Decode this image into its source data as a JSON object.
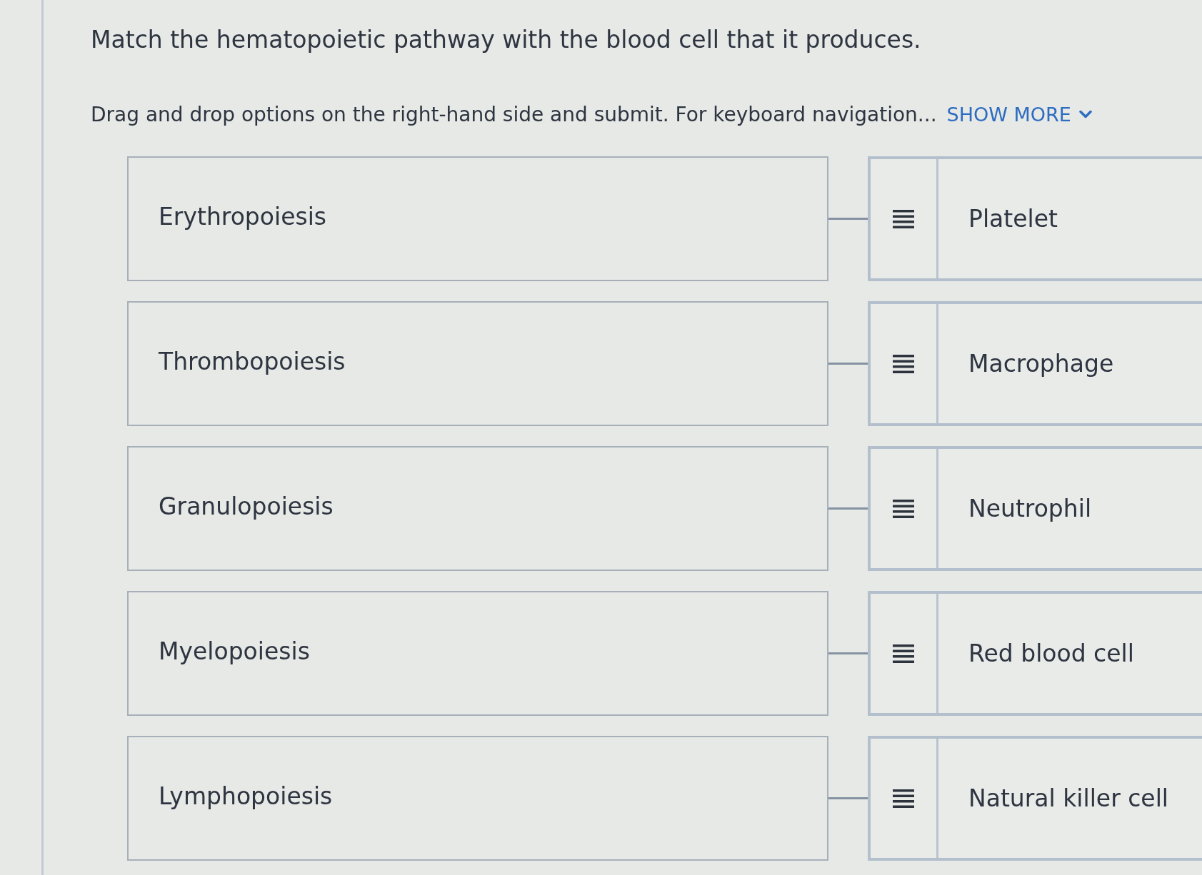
{
  "prompt": {
    "title": "Match the hematopoietic pathway with the blood cell that it produces.",
    "instructions": "Drag and drop options on the right-hand side and submit. For keyboard navigation...",
    "show_more": "SHOW MORE"
  },
  "rows": [
    {
      "pathway": "Erythropoiesis",
      "option": "Platelet"
    },
    {
      "pathway": "Thrombopoiesis",
      "option": "Macrophage"
    },
    {
      "pathway": "Granulopoiesis",
      "option": "Neutrophil"
    },
    {
      "pathway": "Myelopoiesis",
      "option": "Red blood cell"
    },
    {
      "pathway": "Lymphopoiesis",
      "option": "Natural killer cell"
    }
  ]
}
